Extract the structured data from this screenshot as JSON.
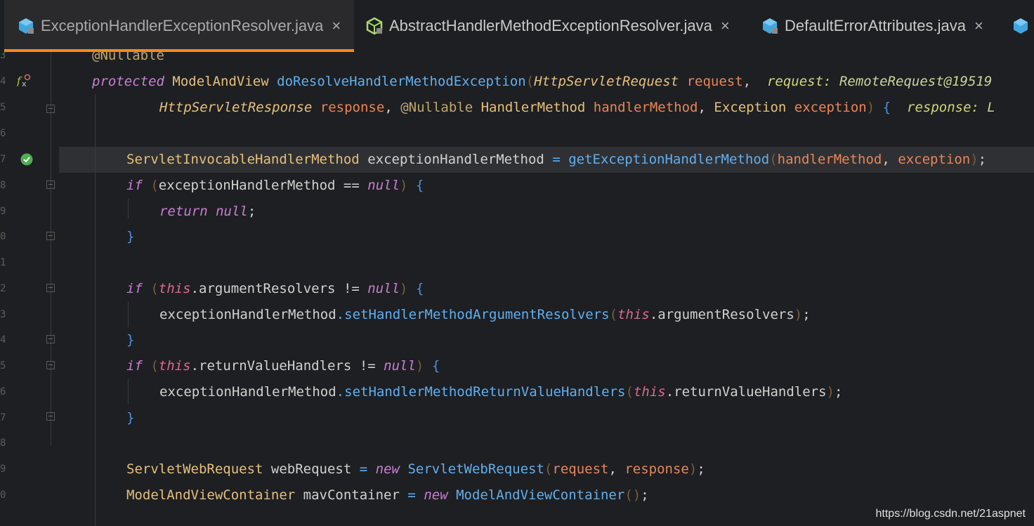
{
  "tabs": [
    {
      "label": "ExceptionHandlerExceptionResolver.java",
      "close": "×",
      "active": true,
      "icon": "java-class-icon"
    },
    {
      "label": "AbstractHandlerMethodExceptionResolver.java",
      "close": "×",
      "active": false,
      "icon": "abstract-class-icon"
    },
    {
      "label": "DefaultErrorAttributes.java",
      "close": "×",
      "active": false,
      "icon": "java-class-icon"
    }
  ],
  "gutter": {
    "line_numbers": [
      "3",
      "4",
      "5",
      "6",
      "7",
      "8",
      "9",
      "0",
      "1",
      "2",
      "3",
      "4",
      "5",
      "6",
      "7",
      "8",
      "9",
      "0"
    ]
  },
  "code": {
    "l3_ann": "@Nullable",
    "l4_protected": "protected",
    "l4_ret": "ModelAndView",
    "l4_fn": "doResolveHandlerMethodException",
    "l4_ptype": "HttpServletRequest",
    "l4_pname": "request",
    "l4_hint_label": "request:",
    "l4_hint_val": "RemoteRequest@19519",
    "l5_ptype": "HttpServletResponse",
    "l5_pname": "response",
    "l5_ann": "@Nullable",
    "l5_ptype2": "HandlerMethod",
    "l5_pname2": "handlerMethod",
    "l5_ptype3": "Exception",
    "l5_pname3": "exception",
    "l5_hint_label": "response:",
    "l5_hint_val": "L",
    "l7_type": "ServletInvocableHandlerMethod",
    "l7_var": "exceptionHandlerMethod",
    "l7_fn": "getExceptionHandlerMethod",
    "l7_a1": "handlerMethod",
    "l7_a2": "exception",
    "l8_if": "if",
    "l8_var": "exceptionHandlerMethod",
    "l8_op": "==",
    "l8_null": "null",
    "l9_return": "return",
    "l9_null": "null",
    "l12_if": "if",
    "l12_this": "this",
    "l12_field": "argumentResolvers",
    "l12_op": "!=",
    "l12_null": "null",
    "l13_var": "exceptionHandlerMethod",
    "l13_fn": "setHandlerMethodArgumentResolvers",
    "l13_this": "this",
    "l13_field": "argumentResolvers",
    "l15_if": "if",
    "l15_this": "this",
    "l15_field": "returnValueHandlers",
    "l15_op": "!=",
    "l15_null": "null",
    "l16_var": "exceptionHandlerMethod",
    "l16_fn": "setHandlerMethodReturnValueHandlers",
    "l16_this": "this",
    "l16_field": "returnValueHandlers",
    "l19_type": "ServletWebRequest",
    "l19_var": "webRequest",
    "l19_new": "new",
    "l19_ctor": "ServletWebRequest",
    "l19_a1": "request",
    "l19_a2": "response",
    "l20_type": "ModelAndViewContainer",
    "l20_var": "mavContainer",
    "l20_new": "new",
    "l20_ctor": "ModelAndViewContainer"
  },
  "watermark": "https://blog.csdn.net/21aspnet",
  "colors": {
    "tab_active_underline": "#f08c1a",
    "background": "#1e1f22",
    "current_line": "#2f3033"
  }
}
